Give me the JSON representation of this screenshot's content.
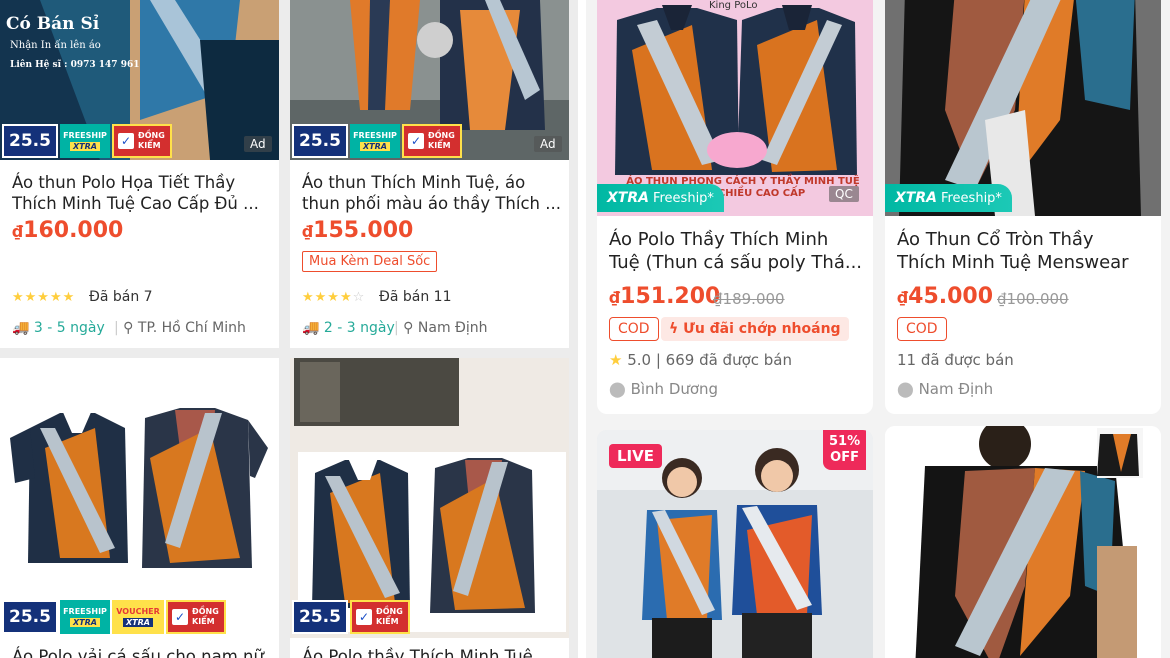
{
  "left_grid": {
    "products": [
      {
        "title_line1": "Áo thun Polo  Họa Tiết Thầy",
        "title_line2": "Thích Minh Tuệ Cao Cấp Đủ ...",
        "currency": "₫",
        "price": "160.000",
        "rating_stars": 5,
        "sold": "Đã bán 7",
        "shipping": "3 - 5 ngày",
        "location": "TP. Hồ Chí Minh",
        "ad_label": "Ad",
        "badge_255": "25.5",
        "badge_freeship": "FREESHIP",
        "badge_xtra": "XTRA",
        "badge_dongkiem": "ĐỒNG KIỂM",
        "overlay_text_1": "Có Bán Sỉ",
        "overlay_text_2": "Nhận In ấn lên áo",
        "overlay_text_3": "Liên Hệ sĩ : 0973 147 961"
      },
      {
        "title_line1": "Áo thun Thích Minh Tuệ, áo",
        "title_line2": "thun phối màu áo thầy Thích ...",
        "currency": "₫",
        "price": "155.000",
        "deal_label": "Mua Kèm Deal Sốc",
        "rating_stars": 4,
        "sold": "Đã bán 11",
        "shipping": "2 - 3 ngày",
        "location": "Nam Định",
        "ad_label": "Ad",
        "badge_255": "25.5",
        "badge_freeship": "FREESHIP",
        "badge_xtra": "XTRA",
        "badge_dongkiem": "ĐỒNG KIỂM"
      },
      {
        "title_line1": "Áo Polo vải cá sấu cho nam nữ",
        "badge_255": "25.5",
        "badge_freeship": "FREESHIP",
        "badge_xtra": "XTRA",
        "badge_voucher": "VOUCHER",
        "badge_dongkiem": "ĐỒNG KIỂM"
      },
      {
        "title_line1": "Áo Polo thầy Thích Minh Tuệ vải",
        "badge_255": "25.5",
        "badge_dongkiem": "ĐỒNG KIỂM"
      }
    ]
  },
  "right_grid": {
    "products": [
      {
        "brand_text": "King PoLo",
        "image_caption_1": "ÁO THUN PHONG CÁCH Y THẦY MINH TUỆ",
        "image_caption_2": "SẤU 4 CHIỀU CAO CẤP",
        "xtra_label": "XTRA",
        "freeship_label": "Freeship*",
        "qc_label": "QC",
        "title_line1": "Áo Polo Thầy Thích Minh",
        "title_line2": "Tuệ (Thun cá sấu poly Thá...",
        "currency": "₫",
        "price": "151.200",
        "old_price": "₫189.000",
        "cod": "COD",
        "promo": "Ưu đãi chớp nhoáng",
        "rating": "5.0 | 669 đã được bán",
        "location": "Bình Dương"
      },
      {
        "xtra_label": "XTRA",
        "freeship_label": "Freeship*",
        "title_line1": "Áo Thun Cổ Tròn Thầy",
        "title_line2": "Thích Minh Tuệ Menswear",
        "currency": "₫",
        "price": "45.000",
        "old_price": "₫100.000",
        "cod": "COD",
        "sold": "11 đã được bán",
        "location": "Nam Định"
      },
      {
        "live_label": "LIVE",
        "discount_pct": "51%",
        "discount_off": "OFF"
      },
      {}
    ]
  },
  "colors": {
    "price": "#ee4d2d",
    "teal": "#26aa99",
    "star": "#ffce3d",
    "badge_navy": "#14317a"
  }
}
